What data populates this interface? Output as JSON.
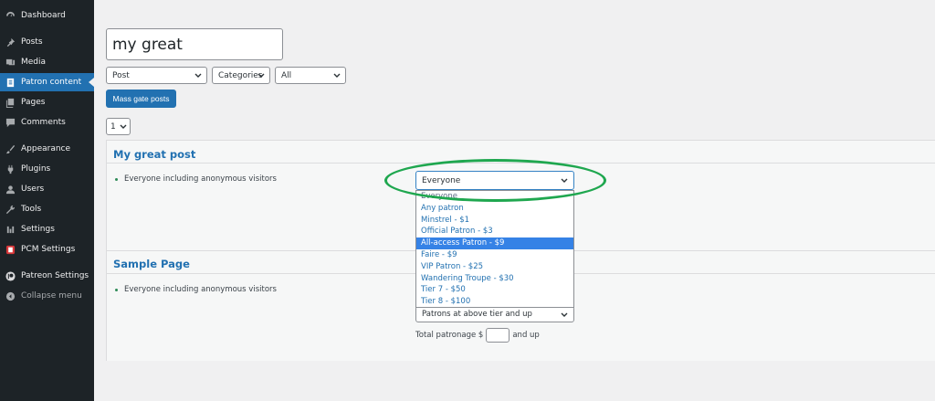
{
  "sidebar": {
    "items": [
      {
        "label": "Dashboard",
        "icon": "dashboard-icon"
      },
      {
        "label": "Posts",
        "icon": "pin-icon"
      },
      {
        "label": "Media",
        "icon": "media-icon"
      },
      {
        "label": "Patron content",
        "icon": "page-icon",
        "active": true
      },
      {
        "label": "Pages",
        "icon": "pages-icon"
      },
      {
        "label": "Comments",
        "icon": "comment-icon"
      },
      {
        "label": "Appearance",
        "icon": "brush-icon"
      },
      {
        "label": "Plugins",
        "icon": "plugin-icon"
      },
      {
        "label": "Users",
        "icon": "user-icon"
      },
      {
        "label": "Tools",
        "icon": "wrench-icon"
      },
      {
        "label": "Settings",
        "icon": "settings-icon"
      },
      {
        "label": "PCM Settings",
        "icon": "pcm-icon"
      },
      {
        "label": "Patreon Settings",
        "icon": "patreon-icon"
      },
      {
        "label": "Collapse menu",
        "icon": "collapse-icon"
      }
    ]
  },
  "filters": {
    "search_value": "my great",
    "post_type": "Post",
    "category": "Categories",
    "status": "All",
    "mass_gate_label": "Mass gate posts",
    "page": "1"
  },
  "posts": [
    {
      "title": "My great post",
      "access_text": "Everyone including anonymous visitors",
      "select_value": "Everyone"
    },
    {
      "title": "Sample Page",
      "access_text": "Everyone including anonymous visitors",
      "tier_select": "Patrons at above tier and up",
      "total_prefix": "Total patronage $",
      "total_suffix": "and up"
    }
  ],
  "dropdown": {
    "options": [
      "Everyone",
      "Any patron",
      "Minstrel - $1",
      "Official Patron - $3",
      "All-access Patron - $9",
      "Faire - $9",
      "VIP Patron - $25",
      "Wandering Troupe - $30",
      "Tier 7 - $50",
      "Tier 8 - $100"
    ],
    "selected_index": 4
  },
  "colors": {
    "sidebar_bg": "#1d2327",
    "accent": "#2271b1",
    "highlight_ellipse": "#1fa74f"
  }
}
